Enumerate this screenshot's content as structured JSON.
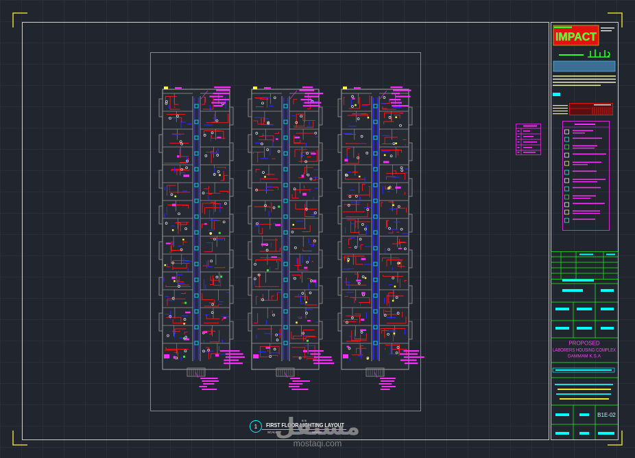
{
  "colors": {
    "background": "#21252d",
    "sheet_border": "#cfcfcf",
    "corner_marks": "#e3d43a",
    "wall": "#9b9b9b",
    "circuit_red": "#ff1a1a",
    "circuit_blue": "#2b2bff",
    "annotation_magenta": "#ff2bff",
    "label_cyan": "#00ffff",
    "table_green": "#19ff19",
    "text_yellow": "#ffff3a",
    "fixture_white": "#f2f2f2"
  },
  "title_block": {
    "logo_text": "IMPACT",
    "project_line_1": "PROPOSED",
    "project_line_2": "LABORERS HOUSING COMPLEX",
    "project_line_3": "DAMMAM K.S.A",
    "sheet_number": "B1E-02"
  },
  "drawing_title": {
    "number": "1",
    "title": "FIRST FLOOR LIGHTING LAYOUT",
    "scale_label": "SCALE"
  },
  "watermark": {
    "arabic": "مستقل",
    "site": "mostaqi.com"
  }
}
